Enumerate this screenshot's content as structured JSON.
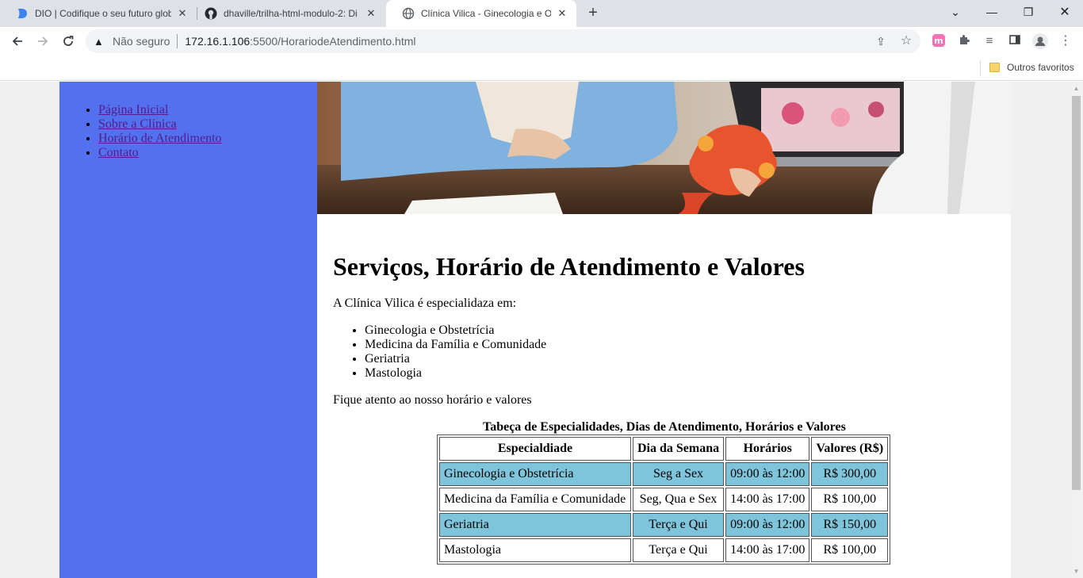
{
  "browser": {
    "tabs": [
      {
        "title": "DIO | Codifique o seu futuro glob",
        "icon": "dio-icon"
      },
      {
        "title": "dhaville/trilha-html-modulo-2: Di",
        "icon": "github-icon"
      },
      {
        "title": "Clínica Vilica - Ginecologia e Obs",
        "icon": "globe-icon",
        "active": true
      }
    ],
    "address": {
      "security_label": "Não seguro",
      "url_host": "172.16.1.106",
      "url_rest": ":5500/HorariodeAtendimento.html"
    },
    "bookmarks": {
      "other_favorites": "Outros favoritos"
    }
  },
  "site": {
    "nav": [
      {
        "label": "Página Inicial"
      },
      {
        "label": "Sobre a Clínica"
      },
      {
        "label": "Horário de Atendimento"
      },
      {
        "label": "Contato"
      }
    ],
    "heading": "Serviços, Horário de Atendimento e Valores",
    "intro": "A Clínica Vilica é especialidaza em:",
    "specialties": [
      "Ginecologia e Obstetrícia",
      "Medicina da Família e Comunidade",
      "Geriatria",
      "Mastologia"
    ],
    "notice": "Fique atento ao nosso horário e valores",
    "table": {
      "caption": "Tabeça de Especialidades, Dias de Atendimento, Horários e Valores",
      "headers": [
        "Especialdiade",
        "Dia da Semana",
        "Horários",
        "Valores (R$)"
      ],
      "rows": [
        [
          "Ginecologia e Obstetrícia",
          "Seg a Sex",
          "09:00 às 12:00",
          "R$ 300,00"
        ],
        [
          "Medicina da Família e Comunidade",
          "Seg, Qua e Sex",
          "14:00 às 17:00",
          "R$ 100,00"
        ],
        [
          "Geriatria",
          "Terça e Qui",
          "09:00 às 12:00",
          "R$ 150,00"
        ],
        [
          "Mastologia",
          "Terça e Qui",
          "14:00 às 17:00",
          "R$ 100,00"
        ]
      ],
      "highlight_color": "#7ec4db"
    },
    "sidebar_color": "#5371ee"
  }
}
